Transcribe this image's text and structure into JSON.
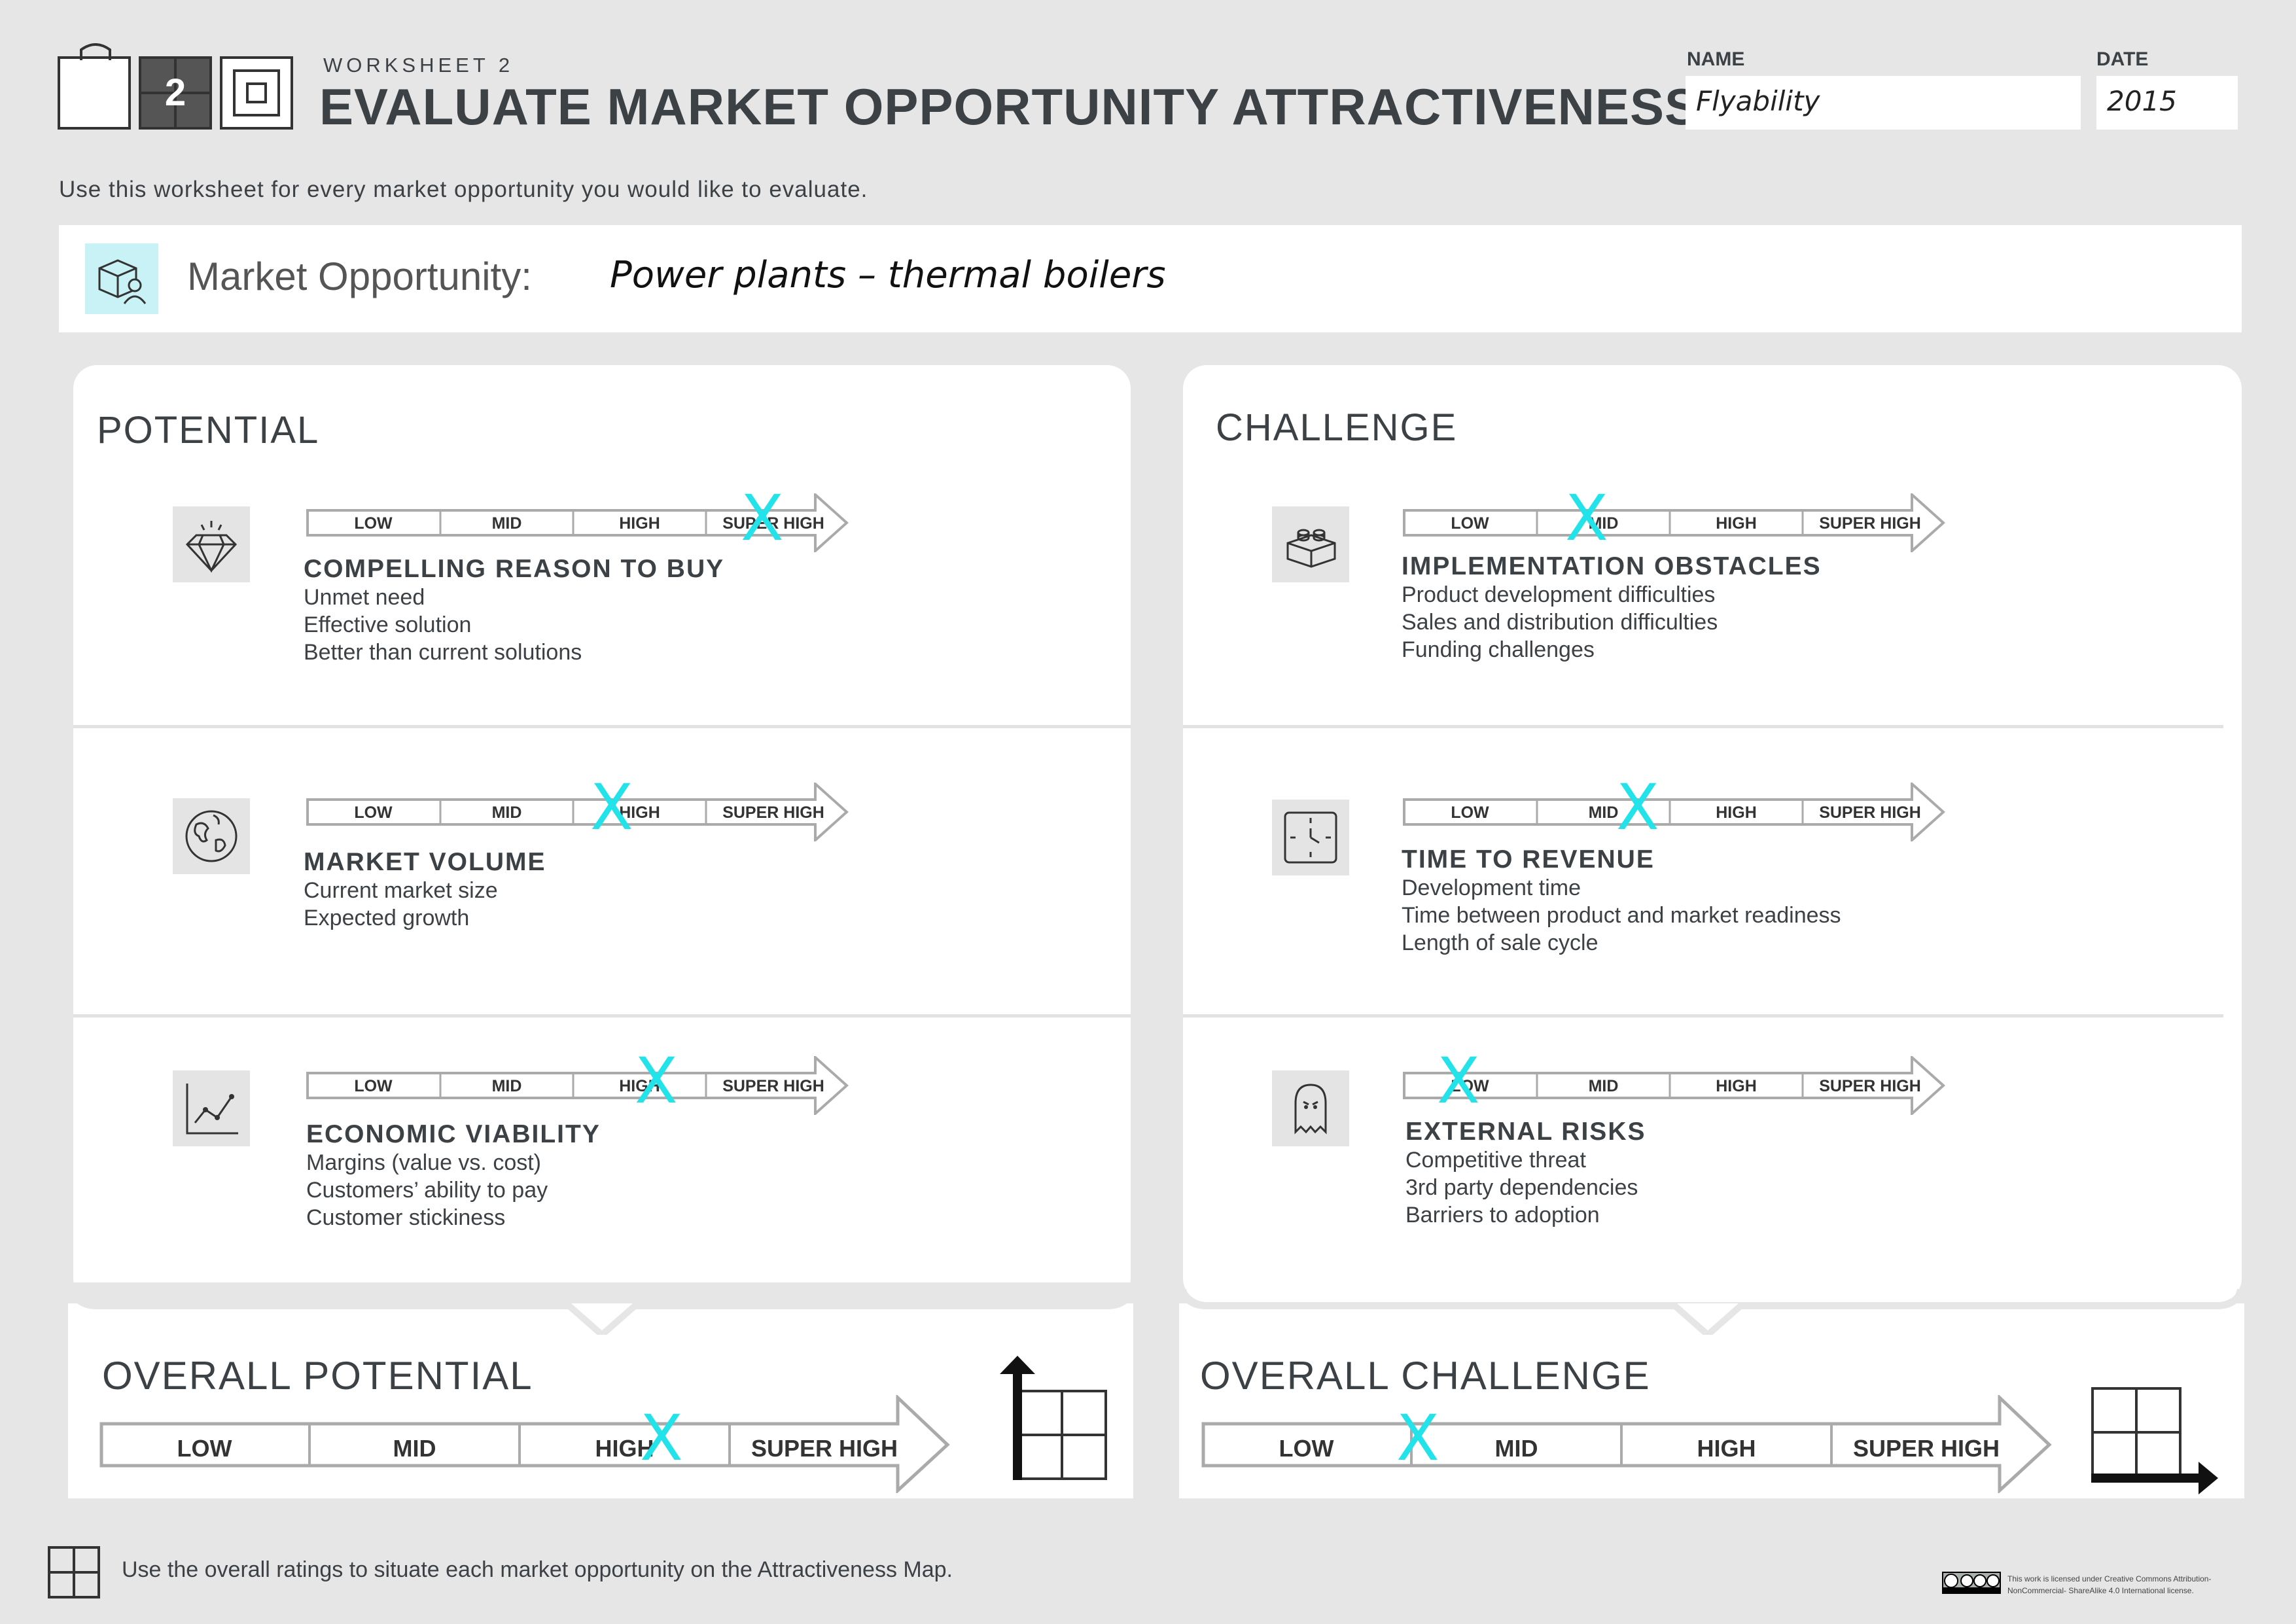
{
  "header": {
    "worksheet_number": "2",
    "worksheet_label": "WORKSHEET 2",
    "title": "EVALUATE MARKET OPPORTUNITY ATTRACTIVENESS",
    "name_label": "NAME",
    "name_value": "Flyability",
    "date_label": "DATE",
    "date_value": "2015"
  },
  "intro": "Use this worksheet for every market opportunity you would like to evaluate.",
  "opportunity": {
    "label": "Market Opportunity:",
    "value": "Power plants – thermal boilers"
  },
  "scale_labels": [
    "LOW",
    "MID",
    "HIGH",
    "SUPER HIGH"
  ],
  "potential": {
    "title": "POTENTIAL",
    "criteria": [
      {
        "icon": "diamond-icon",
        "title": "COMPELLING REASON TO BUY",
        "lines": [
          "Unmet need",
          "Effective solution",
          "Better than current solutions"
        ],
        "rating": "SUPER HIGH"
      },
      {
        "icon": "globe-icon",
        "title": "MARKET VOLUME",
        "lines": [
          "Current market size",
          "Expected growth"
        ],
        "rating": "HIGH"
      },
      {
        "icon": "line-chart-icon",
        "title": "ECONOMIC VIABILITY",
        "lines": [
          "Margins (value vs. cost)",
          "Customers’ ability to pay",
          "Customer stickiness"
        ],
        "rating": "HIGH"
      }
    ],
    "overall_title": "OVERALL POTENTIAL",
    "overall_rating": "HIGH"
  },
  "challenge": {
    "title": "CHALLENGE",
    "criteria": [
      {
        "icon": "lego-brick-icon",
        "title": "IMPLEMENTATION OBSTACLES",
        "lines": [
          "Product development difficulties",
          "Sales and distribution difficulties",
          "Funding challenges"
        ],
        "rating": "MID"
      },
      {
        "icon": "clock-icon",
        "title": "TIME TO REVENUE",
        "lines": [
          "Development time",
          "Time between product and market readiness",
          "Length of sale cycle"
        ],
        "rating": "MID"
      },
      {
        "icon": "ghost-icon",
        "title": "EXTERNAL RISKS",
        "lines": [
          "Competitive threat",
          "3rd party dependencies",
          "Barriers to adoption"
        ],
        "rating": "LOW"
      }
    ],
    "overall_title": "OVERALL CHALLENGE",
    "overall_rating": "LOW"
  },
  "mark_glyph": "X",
  "footer": {
    "text": "Use the overall ratings to situate each market opportunity on the Attractiveness Map.",
    "license": "This work is licensed under Creative Commons Attribution-NonCommercial- ShareAlike 4.0 International license."
  },
  "colors": {
    "mark": "#22e3ea",
    "text": "#3c4146",
    "background": "#e6e6e6"
  }
}
